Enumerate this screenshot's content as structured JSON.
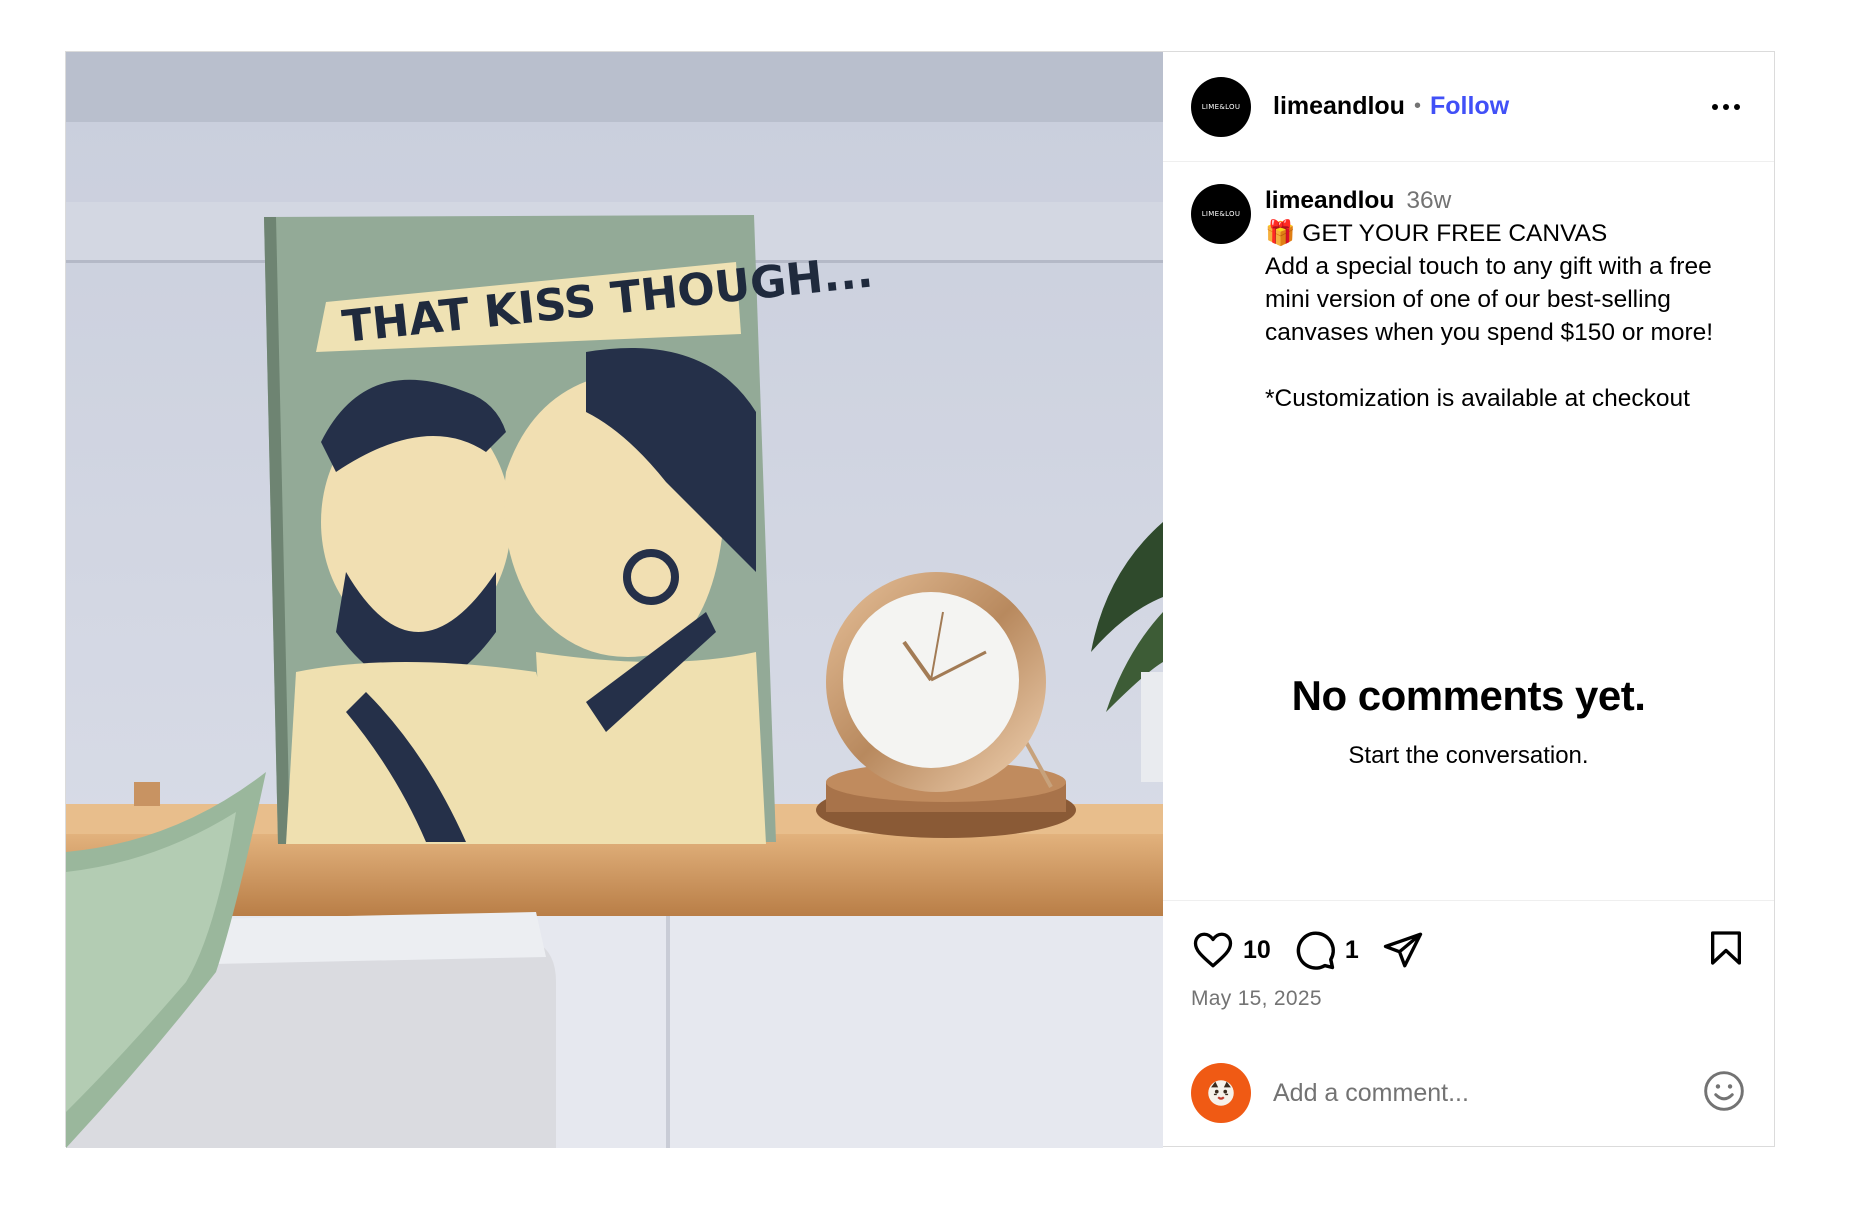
{
  "post": {
    "image_text": "THAT KISS THOUGH...",
    "author": {
      "username": "limeandlou",
      "avatar_text": "LIME&LOU",
      "follow_label": "Follow",
      "separator": "•"
    },
    "caption": {
      "username": "limeandlou",
      "time_ago": "36w",
      "lines": [
        "🎁 GET YOUR FREE CANVAS",
        "Add a special touch to any gift with a free mini version of one of our best-selling canvases when you spend $150 or more!",
        "",
        "*Customization is available at checkout"
      ]
    },
    "empty_state": {
      "title": "No comments yet.",
      "subtitle": "Start the conversation."
    },
    "actions": {
      "like_count": "10",
      "comment_count": "1",
      "icons": [
        "heart-icon",
        "comment-icon",
        "share-icon",
        "bookmark-icon"
      ]
    },
    "date": "May 15, 2025",
    "comment_box": {
      "placeholder": "Add a comment..."
    },
    "colors": {
      "follow": "#4150f7",
      "muted": "#737373",
      "border": "#dbdbdb",
      "my_avatar": "#f05a14"
    }
  }
}
